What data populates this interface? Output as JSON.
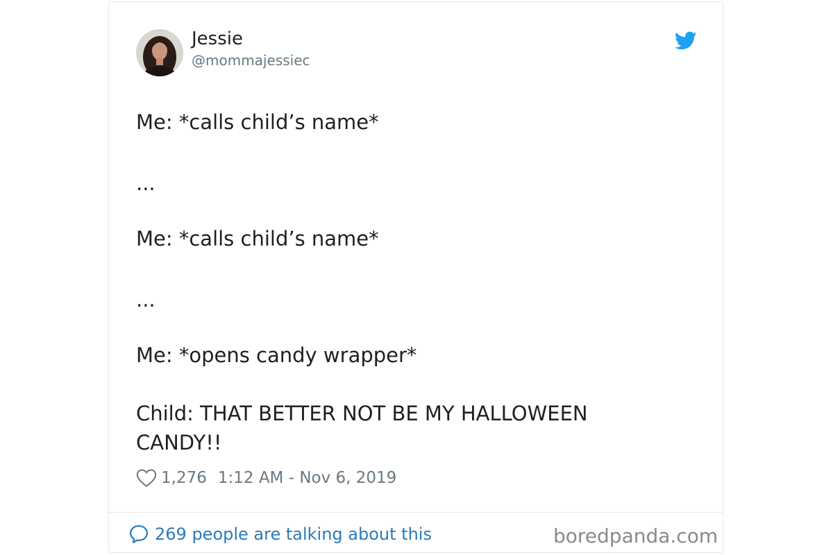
{
  "tweet": {
    "author": {
      "display_name": "Jessie",
      "handle": "@mommajessiec",
      "avatar_icon": "user-avatar-photo"
    },
    "brand_icon": "twitter-bird-icon",
    "lines": [
      "Me: *calls child’s name*",
      "...",
      "Me: *calls child’s name*",
      "...",
      "Me: *opens candy wrapper*",
      "Child: THAT BETTER NOT BE MY HALLOWEEN",
      "CANDY!!"
    ],
    "likes": "1,276",
    "timestamp": "1:12 AM - Nov 6, 2019"
  },
  "footer": {
    "talking_text": "269 people are talking about this",
    "watermark": "boredpanda.com"
  },
  "colors": {
    "brand_blue": "#1da1f2",
    "link_blue": "#2b7bb9",
    "text": "#1c2022",
    "muted": "#697882",
    "border": "#e1e8ed"
  }
}
